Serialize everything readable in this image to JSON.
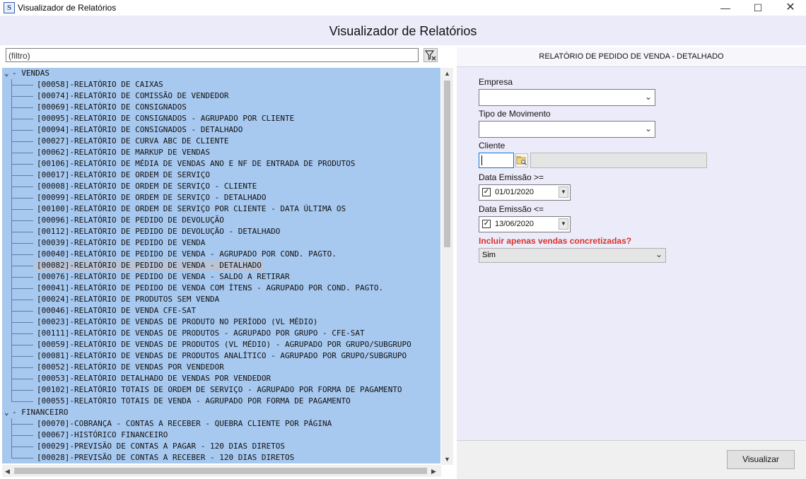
{
  "window": {
    "title": "Visualizador de Relatórios",
    "minimize_icon": "minimize-icon",
    "maximize_icon": "maximize-icon",
    "close_icon": "close-icon"
  },
  "header": {
    "title": "Visualizador de Relatórios"
  },
  "filter": {
    "placeholder": "(filtro)",
    "clear_icon": "filter-clear-icon"
  },
  "tree": {
    "vendas": {
      "label": "VENDAS",
      "items": [
        "[00058]-RELATÓRIO DE CAIXAS",
        "[00074]-RELATÓRIO DE COMISSÃO DE VENDEDOR",
        "[00069]-RELATÓRIO DE CONSIGNADOS",
        "[00095]-RELATÓRIO DE CONSIGNADOS - AGRUPADO POR CLIENTE",
        "[00094]-RELATÓRIO DE CONSIGNADOS - DETALHADO",
        "[00027]-RELATÓRIO DE CURVA ABC DE CLIENTE",
        "[00062]-RELATÓRIO DE MARKUP DE VENDAS",
        "[00106]-RELATÓRIO DE MÉDIA DE VENDAS ANO E NF DE ENTRADA DE PRODUTOS",
        "[00017]-RELATÓRIO DE ORDEM DE SERVIÇO",
        "[00008]-RELATÓRIO DE ORDEM DE SERVIÇO - CLIENTE",
        "[00099]-RELATÓRIO DE ORDEM DE SERVIÇO - DETALHADO",
        "[00100]-RELATÓRIO DE ORDEM DE SERVIÇO POR CLIENTE - DATA ÚLTIMA OS",
        "[00096]-RELATÓRIO DE PEDIDO DE DEVOLUÇÃO",
        "[00112]-RELATÓRIO DE PEDIDO DE DEVOLUÇÃO - DETALHADO",
        "[00039]-RELATÓRIO DE PEDIDO DE VENDA",
        "[00040]-RELATÓRIO DE PEDIDO DE VENDA - AGRUPADO POR COND. PAGTO.",
        "[00082]-RELATÓRIO DE PEDIDO DE VENDA - DETALHADO",
        "[00076]-RELATÓRIO DE PEDIDO DE VENDA - SALDO A RETIRAR",
        "[00041]-RELATÓRIO DE PEDIDO DE VENDA COM ÍTENS - AGRUPADO POR COND. PAGTO.",
        "[00024]-RELATÓRIO DE PRODUTOS SEM VENDA",
        "[00046]-RELATÓRIO DE VENDA CFE-SAT",
        "[00023]-RELATÓRIO DE VENDAS DE PRODUTO NO PERÍODO (VL MÉDIO)",
        "[00111]-RELATÓRIO DE VENDAS DE PRODUTOS - AGRUPADO POR GRUPO - CFE-SAT",
        "[00059]-RELATÓRIO DE VENDAS DE PRODUTOS (VL MÉDIO) - AGRUPADO POR GRUPO/SUBGRUPO",
        "[00081]-RELATÓRIO DE VENDAS DE PRODUTOS ANALÍTICO - AGRUPADO POR GRUPO/SUBGRUPO",
        "[00052]-RELATÓRIO DE VENDAS POR VENDEDOR",
        "[00053]-RELATÓRIO DETALHADO DE VENDAS POR VENDEDOR",
        "[00102]-RELATÓRIO TOTAIS DE ORDEM DE SERVIÇO - AGRUPADO POR FORMA DE PAGAMENTO",
        "[00055]-RELATÓRIO TOTAIS DE VENDA - AGRUPADO POR FORMA DE PAGAMENTO"
      ],
      "selected_index": 16
    },
    "financeiro": {
      "label": "FINANCEIRO",
      "items": [
        "[00070]-COBRANÇA - CONTAS A RECEBER - QUEBRA CLIENTE POR PÁGINA",
        "[00067]-HISTÓRICO FINANCEIRO",
        "[00029]-PREVISÃO DE CONTAS A PAGAR - 120 DIAS DIRETOS",
        "[00028]-PREVISÃO DE CONTAS A RECEBER - 120 DIAS DIRETOS"
      ]
    },
    "collapse_glyph": "- "
  },
  "report": {
    "title": "RELATÓRIO DE PEDIDO DE VENDA - DETALHADO",
    "empresa_label": "Empresa",
    "empresa_value": "",
    "tipo_label": "Tipo de Movimento",
    "tipo_value": "",
    "cliente_label": "Cliente",
    "cliente_code": "",
    "cliente_name": "",
    "data_inicio_label": "Data Emissão >=",
    "data_inicio_value": "01/01/2020",
    "data_inicio_checked": true,
    "data_fim_label": "Data Emissão <=",
    "data_fim_value": "13/06/2020",
    "data_fim_checked": true,
    "concretizadas_label": "Incluir apenas vendas concretizadas?",
    "concretizadas_value": "Sim",
    "concretizadas_color": "#d8342a"
  },
  "actions": {
    "visualizar_label": "Visualizar"
  }
}
